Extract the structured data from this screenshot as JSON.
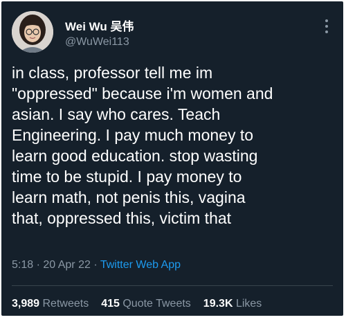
{
  "tweet": {
    "author": {
      "display_name": "Wei Wu 吴伟",
      "handle": "@WuWei113"
    },
    "text": "in class, professor tell me im\n\"oppressed\" because i'm women and\nasian. I say who cares. Teach\nEngineering. I pay much money to\nlearn good education. stop wasting\ntime to be stupid. I pay money to\nlearn math, not penis this, vagina\nthat, oppressed this, victim that",
    "time": "5:18",
    "date": "20 Apr 22",
    "separator": "·",
    "source": "Twitter Web App",
    "stats": {
      "retweets": {
        "count": "3,989",
        "label": "Retweets"
      },
      "quote_tweets": {
        "count": "415",
        "label": "Quote Tweets"
      },
      "likes": {
        "count": "19.3K",
        "label": "Likes"
      }
    }
  },
  "icons": {
    "more": "more-options-icon"
  },
  "colors": {
    "background": "#15202b",
    "text": "#ffffff",
    "secondary_text": "#8b98a5",
    "link": "#1d9bf0",
    "divider": "#38444d"
  }
}
